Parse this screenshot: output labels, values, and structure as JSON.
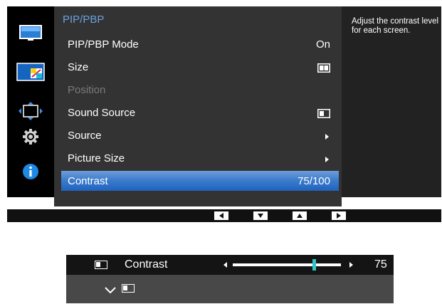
{
  "menu": {
    "title": "PIP/PBP",
    "items": [
      {
        "label": "PIP/PBP Mode",
        "value": "On",
        "state": "normal"
      },
      {
        "label": "Size",
        "value_icon": "side-by-side-icon",
        "state": "normal"
      },
      {
        "label": "Position",
        "state": "disabled"
      },
      {
        "label": "Sound Source",
        "value_icon": "left-screen-icon",
        "state": "normal"
      },
      {
        "label": "Source",
        "value_icon": "arrow-right-icon",
        "state": "normal"
      },
      {
        "label": "Picture Size",
        "value_icon": "arrow-right-icon",
        "state": "normal"
      },
      {
        "label": "Contrast",
        "value": "75/100",
        "state": "selected"
      }
    ]
  },
  "help_text": "Adjust the contrast level for each screen.",
  "sidebar_icons": [
    "picture-icon",
    "pip-pbp-icon",
    "screen-adjust-icon",
    "settings-gear-icon",
    "info-icon"
  ],
  "nav_buttons": [
    "left-arrow-icon",
    "down-arrow-icon",
    "up-arrow-icon",
    "right-arrow-icon"
  ],
  "contrast_strip": {
    "label": "Contrast",
    "value": "75",
    "level": 0.75
  },
  "colors": {
    "accent": "#2f72c8",
    "menu_title": "#6ba0e0",
    "slider_thumb": "#2fc6c8"
  }
}
